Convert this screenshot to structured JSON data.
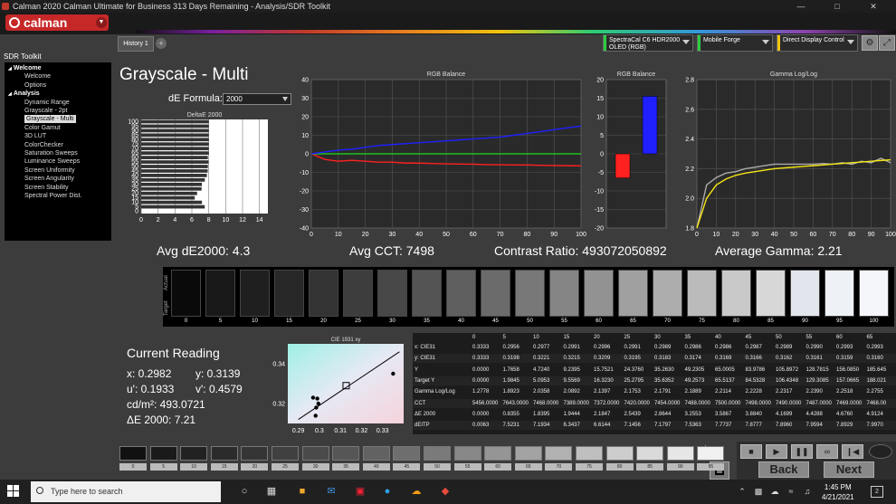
{
  "window": {
    "title": "Calman 2020 Calman Ultimate for Business 313 Days Remaining  - Analysis/SDR Toolkit"
  },
  "logo": "calman",
  "sidebar": {
    "header": "SDR Toolkit",
    "items": [
      {
        "label": "Welcome",
        "level": 0,
        "group": true
      },
      {
        "label": "Welcome",
        "level": 1
      },
      {
        "label": "Options",
        "level": 1
      },
      {
        "label": "Analysis",
        "level": 0,
        "group": true
      },
      {
        "label": "Dynamic Range",
        "level": 1
      },
      {
        "label": "Grayscale - 2pt",
        "level": 1
      },
      {
        "label": "Grayscale - Multi",
        "level": 1,
        "selected": true
      },
      {
        "label": "Color Gamut",
        "level": 1
      },
      {
        "label": "3D LUT",
        "level": 1
      },
      {
        "label": "ColorChecker",
        "level": 1
      },
      {
        "label": "Saturation Sweeps",
        "level": 1
      },
      {
        "label": "Luminance Sweeps",
        "level": 1
      },
      {
        "label": "Screen Uniformity",
        "level": 1
      },
      {
        "label": "Screen Angularity",
        "level": 1
      },
      {
        "label": "Screen Stability",
        "level": 1
      },
      {
        "label": "Spectral Power Dist.",
        "level": 1
      }
    ]
  },
  "tabs": {
    "history": "History 1",
    "add": "+"
  },
  "devices": [
    {
      "line1": "SpectraCal C6 HDR2000",
      "line2": "OLED (RGB)",
      "color": "#2ecc40"
    },
    {
      "line1": "Mobile Forge",
      "line2": "",
      "color": "#2ecc40"
    },
    {
      "line1": "Direct Display Control",
      "line2": "",
      "color": "#f1c40f"
    }
  ],
  "main": {
    "title": "Grayscale - Multi",
    "de_formula_label": "dE Formula:",
    "de_formula_value": "2000",
    "stats": {
      "avg_de": "Avg dE2000: 4.3",
      "avg_cct": "Avg CCT: 7498",
      "contrast": "Contrast Ratio: 493072050892",
      "avg_gamma": "Average Gamma: 2.21"
    }
  },
  "chart_data": [
    {
      "type": "bar",
      "title": "DeltaE 2000",
      "orientation": "horizontal",
      "categories": [
        "0",
        "5",
        "10",
        "15",
        "20",
        "25",
        "30",
        "35",
        "40",
        "45",
        "50",
        "55",
        "60",
        "65",
        "70",
        "75",
        "80",
        "85",
        "90",
        "95",
        "100"
      ],
      "values": [
        0.0063,
        7.5231,
        7.1934,
        6.3437,
        6.6144,
        7.1456,
        7.1797,
        7.5363,
        7.7737,
        7.8777,
        7.896,
        7.9594,
        7.8929,
        7.997,
        8.0,
        8.0,
        8.0,
        8.0,
        8.0,
        8.0,
        8.0
      ],
      "xlim": [
        0,
        15
      ],
      "xticks": [
        0,
        2,
        4,
        6,
        8,
        10,
        12,
        14
      ],
      "yticks": [
        "0",
        "5",
        "10",
        "15",
        "20",
        "25",
        "30",
        "35",
        "40",
        "45",
        "50",
        "55",
        "60",
        "65",
        "70",
        "75",
        "80",
        "85",
        "90",
        "95",
        "100"
      ]
    },
    {
      "type": "line",
      "title": "RGB Balance",
      "x": [
        0,
        5,
        10,
        15,
        20,
        25,
        30,
        35,
        40,
        45,
        50,
        55,
        60,
        65,
        70,
        75,
        80,
        85,
        90,
        95,
        100
      ],
      "series": [
        {
          "color": "#ff2020",
          "values": [
            0,
            -3,
            -4,
            -3.5,
            -4,
            -4.5,
            -4.5,
            -5,
            -5,
            -5.2,
            -5.4,
            -5.5,
            -5.6,
            -5.8,
            -5.9,
            -6,
            -6,
            -6.2,
            -6.3,
            -6.4,
            -6.5
          ]
        },
        {
          "color": "#20c020",
          "values": [
            0,
            0,
            0,
            0,
            0,
            0,
            0,
            0,
            0,
            0,
            0,
            0,
            0,
            0,
            0,
            0,
            0,
            0,
            0,
            0,
            0
          ]
        },
        {
          "color": "#2020ff",
          "values": [
            0,
            1,
            2,
            2.5,
            3.5,
            4.5,
            5,
            5.5,
            6,
            6.5,
            7,
            7.5,
            8,
            8.5,
            9,
            10,
            11,
            12,
            13,
            14,
            15
          ]
        }
      ],
      "xlim": [
        0,
        100
      ],
      "ylim": [
        -40,
        40
      ],
      "xticks": [
        0,
        10,
        20,
        30,
        40,
        50,
        60,
        70,
        80,
        90,
        100
      ],
      "yticks": [
        -40,
        -30,
        -20,
        -10,
        0,
        10,
        20,
        30,
        40
      ]
    },
    {
      "type": "bar",
      "title": "RGB Balance",
      "categories": [
        "R",
        "B"
      ],
      "values": [
        -6.5,
        15.5
      ],
      "colors": [
        "#ff2020",
        "#2020ff"
      ],
      "ylim": [
        -20,
        20
      ],
      "yticks": [
        -20,
        -15,
        -10,
        -5,
        0,
        5,
        10,
        15,
        20
      ]
    },
    {
      "type": "line",
      "title": "Gamma Log/Log",
      "x": [
        0,
        5,
        10,
        15,
        20,
        25,
        30,
        35,
        40,
        45,
        50,
        55,
        60,
        65,
        70,
        75,
        80,
        85,
        90,
        95,
        100
      ],
      "series": [
        {
          "color": "#aaaaaa",
          "values": [
            1.8,
            2.09,
            2.14,
            2.17,
            2.18,
            2.2,
            2.21,
            2.22,
            2.23,
            2.23,
            2.23,
            2.23,
            2.23,
            2.235,
            2.23,
            2.24,
            2.23,
            2.25,
            2.24,
            2.27,
            2.24
          ]
        },
        {
          "color": "#f5e616",
          "values": [
            1.8,
            2.0,
            2.09,
            2.13,
            2.155,
            2.17,
            2.18,
            2.19,
            2.2,
            2.205,
            2.21,
            2.215,
            2.22,
            2.225,
            2.23,
            2.235,
            2.24,
            2.245,
            2.25,
            2.255,
            2.26
          ]
        }
      ],
      "xlim": [
        0,
        100
      ],
      "ylim": [
        1.8,
        2.8
      ],
      "xticks": [
        0,
        10,
        20,
        30,
        40,
        50,
        60,
        70,
        80,
        90,
        100
      ],
      "yticks": [
        1.8,
        2.0,
        2.2,
        2.4,
        2.6,
        2.8
      ]
    },
    {
      "type": "scatter",
      "title": "CIE 1931 xy",
      "xticks": [
        0.29,
        0.3,
        0.31,
        0.32,
        0.33
      ],
      "yticks": [
        0.32,
        0.34
      ],
      "xlim": [
        0.285,
        0.34
      ],
      "ylim": [
        0.31,
        0.35
      ],
      "points": [
        {
          "x": 0.2982,
          "y": 0.3139
        },
        {
          "x": 0.2985,
          "y": 0.318
        },
        {
          "x": 0.297,
          "y": 0.323
        },
        {
          "x": 0.299,
          "y": 0.3225
        },
        {
          "x": 0.2995,
          "y": 0.32
        },
        {
          "x": 0.335,
          "y": 0.335
        }
      ],
      "target": {
        "x": 0.3127,
        "y": 0.329
      }
    }
  ],
  "swatches": {
    "labels": [
      "0",
      "5",
      "10",
      "15",
      "20",
      "25",
      "30",
      "35",
      "40",
      "45",
      "50",
      "55",
      "60",
      "65",
      "70",
      "75",
      "80",
      "85",
      "90",
      "95",
      "100"
    ],
    "colors": [
      "#0a0a0a",
      "#181818",
      "#1f1f1f",
      "#282828",
      "#333333",
      "#3d3d3d",
      "#484848",
      "#545454",
      "#5f5f5f",
      "#6b6b6b",
      "#787878",
      "#858585",
      "#929292",
      "#a0a0a0",
      "#adadad",
      "#bbbbbb",
      "#c9c9c9",
      "#d7d7d7",
      "#e2e6ec",
      "#eef1f6",
      "#f5f6fa"
    ],
    "actual_label": "Actual",
    "target_label": "Target"
  },
  "current_reading": {
    "title": "Current Reading",
    "x": "x: 0.2982",
    "y": "y: 0.3139",
    "u": "u': 0.1933",
    "v": "v': 0.4579",
    "cd": "cd/m²: 493.0721",
    "de": "ΔE 2000: 7.21"
  },
  "table": {
    "columns": [
      "0",
      "5",
      "10",
      "15",
      "20",
      "25",
      "30",
      "35",
      "40",
      "45",
      "50",
      "55",
      "60",
      "65"
    ],
    "rows": [
      {
        "label": "x: CIE31",
        "values": [
          "0.3333",
          "0.2956",
          "0.2977",
          "0.2991",
          "0.2996",
          "0.2991",
          "0.2989",
          "0.2986",
          "0.2986",
          "0.2987",
          "0.2989",
          "0.2990",
          "0.2993",
          "0.2993"
        ]
      },
      {
        "label": "y: CIE31",
        "values": [
          "0.3333",
          "0.3198",
          "0.3221",
          "0.3215",
          "0.3209",
          "0.3195",
          "0.3183",
          "0.3174",
          "0.3169",
          "0.3166",
          "0.3162",
          "0.3161",
          "0.3159",
          "0.3160"
        ]
      },
      {
        "label": "Y",
        "values": [
          "0.0000",
          "1.7658",
          "4.7240",
          "9.2395",
          "15.7521",
          "24.3760",
          "35.2630",
          "49.2305",
          "65.0005",
          "83.9786",
          "105.8972",
          "128.7815",
          "156.0850",
          "185.645"
        ]
      },
      {
        "label": "Target Y",
        "values": [
          "0.0000",
          "1.9845",
          "5.0953",
          "9.5569",
          "16.3230",
          "25.2795",
          "35.6352",
          "49.2573",
          "65.5137",
          "84.5328",
          "106.4348",
          "129.3085",
          "157.0665",
          "188.021"
        ]
      },
      {
        "label": "Gamma Log/Log",
        "values": [
          "1.2778",
          "1.8923",
          "2.0358",
          "2.0892",
          "2.1397",
          "2.1753",
          "2.1791",
          "2.1889",
          "2.2114",
          "2.2228",
          "2.2317",
          "2.2390",
          "2.2518",
          "2.2755"
        ]
      },
      {
        "label": "CCT",
        "values": [
          "5456.0000",
          "7643.0000",
          "7468.0000",
          "7389.0000",
          "7372.0000",
          "7420.0000",
          "7454.0000",
          "7488.0000",
          "7500.0000",
          "7498.0000",
          "7490.0000",
          "7487.0000",
          "7469.0000",
          "7468.00"
        ]
      },
      {
        "label": "ΔE 2000",
        "values": [
          "0.0000",
          "0.8355",
          "1.8395",
          "1.9444",
          "2.1847",
          "2.5439",
          "2.8644",
          "3.2553",
          "3.5867",
          "3.8840",
          "4.1699",
          "4.4288",
          "4.6760",
          "4.9124"
        ]
      },
      {
        "label": "dEITP",
        "values": [
          "0.0063",
          "7.5231",
          "7.1934",
          "6.3437",
          "6.6144",
          "7.1456",
          "7.1797",
          "7.5363",
          "7.7737",
          "7.8777",
          "7.8960",
          "7.9594",
          "7.8929",
          "7.9970"
        ]
      }
    ]
  },
  "thumbs": {
    "labels": [
      "0",
      "5",
      "10",
      "15",
      "20",
      "25",
      "30",
      "35",
      "40",
      "45",
      "50",
      "55",
      "60",
      "65",
      "70",
      "75",
      "80",
      "85",
      "90",
      "95"
    ],
    "colors": [
      "#111",
      "#1a1a1a",
      "#222",
      "#2b2b2b",
      "#353535",
      "#404040",
      "#4a4a4a",
      "#565656",
      "#626262",
      "#6e6e6e",
      "#7a7a7a",
      "#888",
      "#959595",
      "#a3a3a3",
      "#b1b1b1",
      "#bfbfbf",
      "#cdcdcd",
      "#dadada",
      "#e6e6e6",
      "#f0f0f0"
    ]
  },
  "nav": {
    "back": "Back",
    "next": "Next"
  },
  "taskbar": {
    "search_placeholder": "Type here to search",
    "time": "1:45 PM",
    "date": "4/21/2021",
    "notifications": "2"
  }
}
